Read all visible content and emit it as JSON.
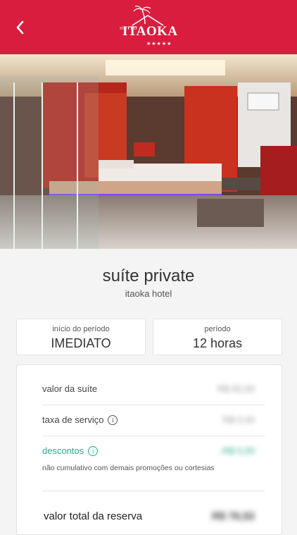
{
  "header": {
    "back_icon": "chevron-left-icon",
    "logo_hotel": "HOTEL",
    "logo_name": "ITAOKA",
    "logo_stars": "★★★★★",
    "color": "#d91d3e"
  },
  "gallery": {
    "dot_count": 13,
    "active_index": 0
  },
  "suite": {
    "name": "suíte private",
    "hotel": "itaoka hotel"
  },
  "period": {
    "start_label": "início do período",
    "start_value": "IMEDIATO",
    "length_label": "período",
    "length_value": "12 horas"
  },
  "summary": {
    "suite_label": "valor da suíte",
    "suite_value": "R$ 82,00",
    "service_label": "taxa de serviço",
    "service_value": "R$ 0,00",
    "discount_label": "descontos",
    "discount_value": "-R$ 0,00",
    "discount_note": "não cumulativo com demais promoções ou cortesias",
    "total_label": "valor total da reserva",
    "total_value": "R$ 76,52",
    "accent": "#2eaa86"
  }
}
